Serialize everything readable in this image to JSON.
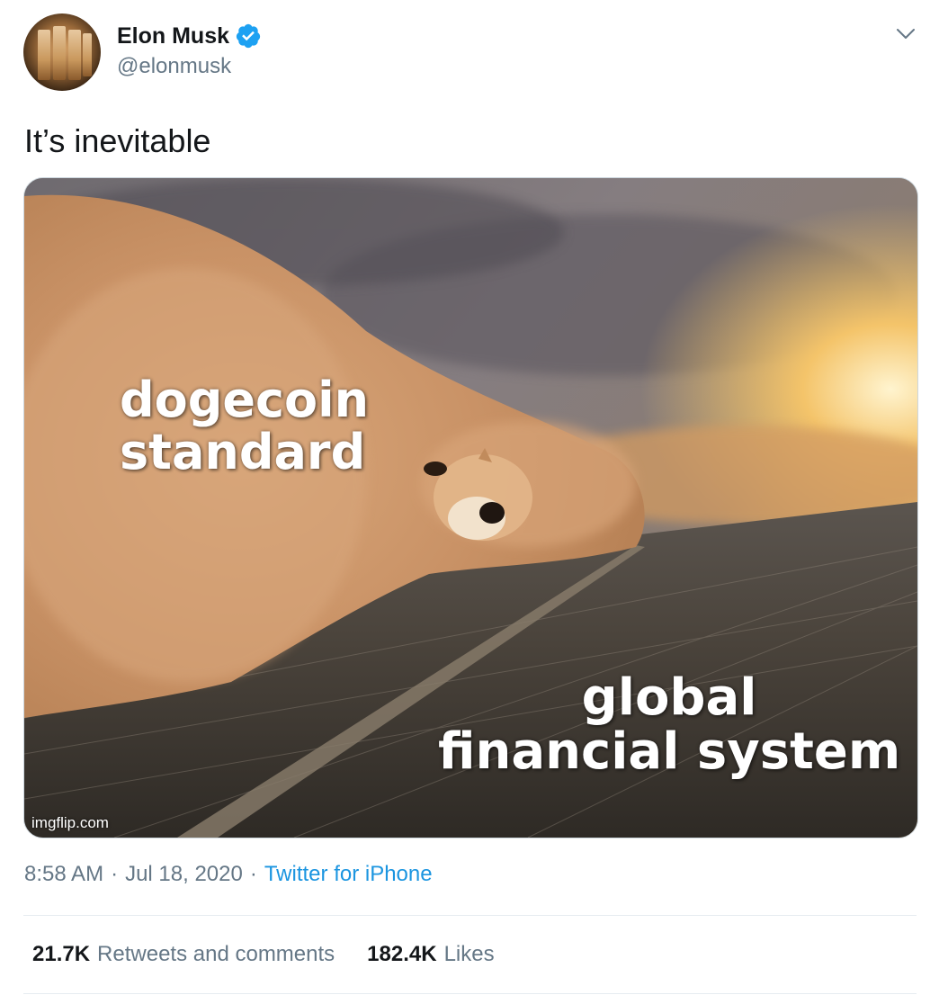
{
  "author": {
    "display_name": "Elon Musk",
    "handle": "@elonmusk",
    "verified": true,
    "avatar_icon": "avatar-image"
  },
  "tweet": {
    "text": "It’s inevitable"
  },
  "media": {
    "top_caption": "dogecoin\nstandard",
    "bottom_caption": "global\nfinancial system",
    "watermark": "imgflip.com"
  },
  "meta": {
    "time": "8:58 AM",
    "separator": "·",
    "date": "Jul 18, 2020",
    "source": "Twitter for iPhone"
  },
  "stats": {
    "retweets_count": "21.7K",
    "retweets_label": "Retweets and comments",
    "likes_count": "182.4K",
    "likes_label": "Likes"
  },
  "colors": {
    "text_primary": "#14171a",
    "text_secondary": "#657786",
    "link": "#1b95e0",
    "verified_badge": "#1da1f2",
    "divider": "#e6ecf0"
  },
  "icons": {
    "verified": "verified-badge-icon",
    "menu": "chevron-down-icon"
  }
}
